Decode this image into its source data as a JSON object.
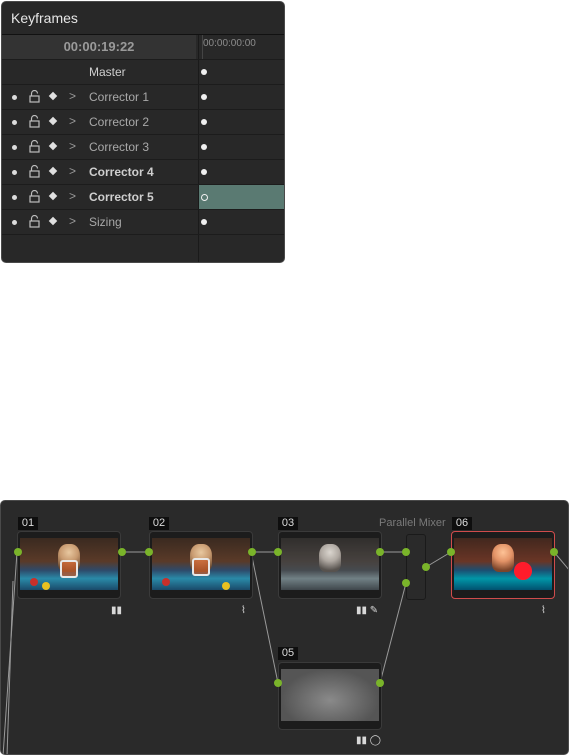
{
  "keyframes": {
    "title": "Keyframes",
    "timecode": "00:00:19:22",
    "ruler_time": "00:00:00:00",
    "rows": [
      {
        "label": "Master",
        "bold": false,
        "master": true,
        "selected": false
      },
      {
        "label": "Corrector 1",
        "bold": false,
        "master": false,
        "selected": false
      },
      {
        "label": "Corrector 2",
        "bold": false,
        "master": false,
        "selected": false
      },
      {
        "label": "Corrector 3",
        "bold": false,
        "master": false,
        "selected": false
      },
      {
        "label": "Corrector 4",
        "bold": true,
        "master": false,
        "selected": false
      },
      {
        "label": "Corrector 5",
        "bold": true,
        "master": false,
        "selected": true
      },
      {
        "label": "Sizing",
        "bold": false,
        "master": false,
        "selected": false
      }
    ]
  },
  "node_graph": {
    "mixer_label": "Parallel Mixer",
    "nodes": [
      {
        "id": "01",
        "icons": "bars-icon"
      },
      {
        "id": "02",
        "icons": "curves-icon"
      },
      {
        "id": "03",
        "icons": "bars-picker-icon"
      },
      {
        "id": "06",
        "icons": "curves-icon"
      },
      {
        "id": "05",
        "icons": "bars-window-icon"
      }
    ]
  },
  "colors": {
    "panel_bg": "#282828",
    "selection": "#5a7a72",
    "port": "#7ab42a",
    "node_selected": "#d04c4c"
  }
}
